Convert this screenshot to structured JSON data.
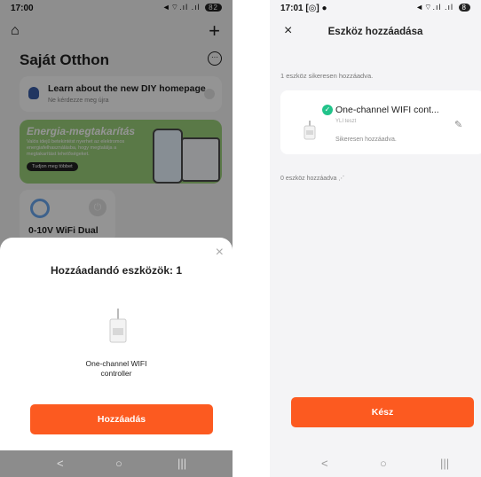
{
  "left": {
    "status": {
      "time": "17:00",
      "time_icon": "●",
      "signal": "◄⌔.ıl .ıl",
      "battery": "82"
    },
    "header": {
      "home_icon": "⌂",
      "add": "+",
      "title": "Saját Otthon",
      "more": "···"
    },
    "info_card": {
      "title": "Learn about the new DIY homepage",
      "subtitle": "Ne kérdezze meg újra"
    },
    "banner": {
      "title": "Energia-megtakarítás",
      "description": "Valós idejű betekintést nyerhet az elektromos energiafelhasználásba, hogy megtalálja a megtakarítást lehetőségeket.",
      "button": "Tudjon meg többet"
    },
    "device_card": {
      "name": "0-10V WiFi Dual"
    },
    "sheet": {
      "close": "×",
      "title": "Hozzáadandó eszközök: 1",
      "device_line1": "One-channel WIFI",
      "device_line2": "controller",
      "add_button": "Hozzáadás"
    },
    "nav": {
      "back": "<",
      "home": "○",
      "recents": "|||"
    }
  },
  "right": {
    "status": {
      "time": "17:01 [◎] ●",
      "signal": "◄⌔.ıl .ıl",
      "battery": "8"
    },
    "header": {
      "close": "×",
      "title": "Eszköz hozzáadása"
    },
    "success_count": "1 eszköz sikeresen hozzáadva.",
    "card": {
      "check": "✓",
      "name": "One-channel WIFI cont...",
      "room": "YLI teszt",
      "status": "Sikeresen hozzáadva.",
      "edit_icon": "✎"
    },
    "pending_count": "0 eszköz hozzáadva ⋰",
    "done_button": "Kész",
    "nav": {
      "back": "<",
      "home": "○",
      "recents": "|||"
    }
  }
}
